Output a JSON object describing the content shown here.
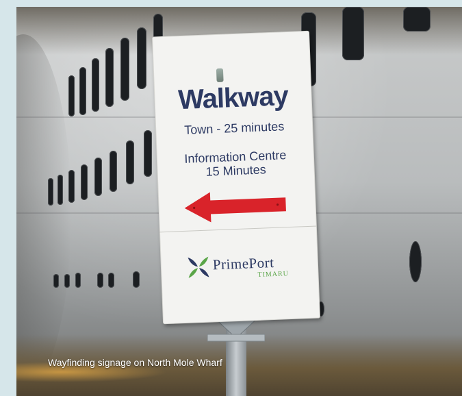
{
  "photo": {
    "alt_icon": "photo",
    "sign": {
      "title": "Walkway",
      "line1": "Town - 25 minutes",
      "line2": "Information Centre",
      "line3": "15 Minutes",
      "arrow_color": "#d9232a",
      "arrow_icon": "arrow-left-icon",
      "logo": {
        "word": "PrimePort",
        "sub": "TIMARU",
        "mark_colors": [
          "#2d3a63",
          "#5aa548"
        ]
      }
    }
  },
  "caption": "Wayfinding signage on North Mole Wharf",
  "colors": {
    "background": "#d6e6ea",
    "sign_text": "#2d3a63"
  }
}
